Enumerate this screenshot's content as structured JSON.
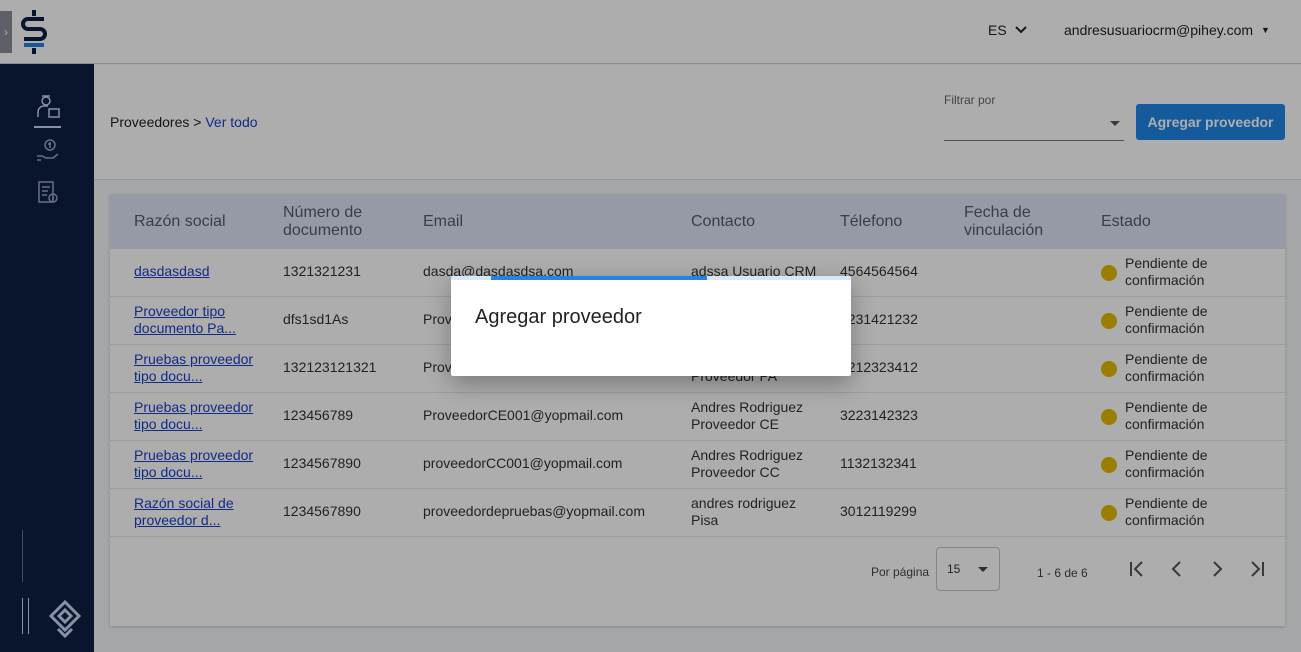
{
  "topbar": {
    "language": "ES",
    "user_email": "andresusuariocrm@pihey.com"
  },
  "sidebar": {
    "items": [
      {
        "icon": "provider-user-icon",
        "active": true
      },
      {
        "icon": "hand-money-icon",
        "active": false
      },
      {
        "icon": "invoice-icon",
        "active": false
      }
    ]
  },
  "breadcrumb": {
    "section": "Proveedores",
    "separator": ">",
    "current": "Ver todo"
  },
  "filter": {
    "label": "Filtrar por",
    "value": ""
  },
  "add_button": "Agregar proveedor",
  "table": {
    "headers": {
      "razon": "Razón social",
      "documento_1": "Número de",
      "documento_2": "documento",
      "email": "Email",
      "contacto": "Contacto",
      "telefono": "Télefono",
      "fecha_1": "Fecha de",
      "fecha_2": "vinculación",
      "estado": "Estado"
    },
    "rows": [
      {
        "razon_1": "dasdasdasd",
        "razon_2": "",
        "documento": "1321321231",
        "email": "dasda@dasdasdsa.com",
        "contacto_1": "adssa Usuario CRM",
        "contacto_2": "",
        "telefono": "4564564564",
        "estado_1": "Pendiente de",
        "estado_2": "confirmación"
      },
      {
        "razon_1": "Proveedor tipo",
        "razon_2": "documento Pa...",
        "documento": "dfs1sd1As",
        "email": "Prov",
        "contacto_1": "",
        "contacto_2": "",
        "telefono": "3231421232",
        "estado_1": "Pendiente de",
        "estado_2": "confirmación"
      },
      {
        "razon_1": "Pruebas proveedor",
        "razon_2": "tipo docu...",
        "documento": "132123121321",
        "email": "Prov",
        "contacto_1": "",
        "contacto_2": "Proveedor PA",
        "telefono": "3212323412",
        "estado_1": "Pendiente de",
        "estado_2": "confirmación"
      },
      {
        "razon_1": "Pruebas proveedor",
        "razon_2": "tipo docu...",
        "documento": "123456789",
        "email": "ProveedorCE001@yopmail.com",
        "contacto_1": "Andres Rodriguez",
        "contacto_2": "Proveedor CE",
        "telefono": "3223142323",
        "estado_1": "Pendiente de",
        "estado_2": "confirmación"
      },
      {
        "razon_1": "Pruebas proveedor",
        "razon_2": "tipo docu...",
        "documento": "1234567890",
        "email": "proveedorCC001@yopmail.com",
        "contacto_1": "Andres Rodriguez",
        "contacto_2": "Proveedor CC",
        "telefono": "1132132341",
        "estado_1": "Pendiente de",
        "estado_2": "confirmación"
      },
      {
        "razon_1": "Razón social de",
        "razon_2": "proveedor d...",
        "documento": "1234567890",
        "email": "proveedordepruebas@yopmail.com",
        "contacto_1": "andres rodriguez",
        "contacto_2": "Pisa",
        "telefono": "3012119299",
        "estado_1": "Pendiente de",
        "estado_2": "confirmación"
      }
    ],
    "status_color": "#e6b800"
  },
  "pagination": {
    "per_page_label": "Por página",
    "per_page_value": "15",
    "range": "1 - 6 de 6"
  },
  "modal": {
    "title": "Agregar proveedor",
    "progress_start": 0.1,
    "progress_fraction": 0.64
  },
  "colors": {
    "sidebar": "#0d1f42",
    "accent": "#1f86e6",
    "link": "#1b3ec9",
    "header_row": "#dde3f5"
  }
}
